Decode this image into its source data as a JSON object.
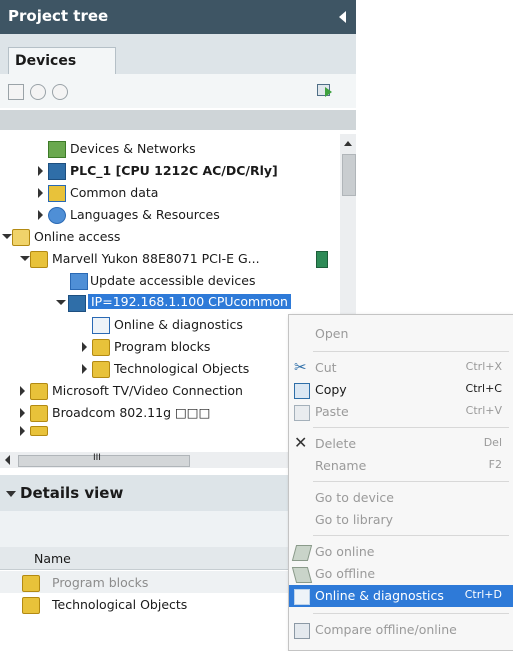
{
  "project_tree": {
    "title": "Project tree",
    "tab": "Devices"
  },
  "tree": {
    "devices_networks": "Devices & Networks",
    "plc": "PLC_1 [CPU 1212C AC/DC/Rly]",
    "common_data": "Common data",
    "languages": "Languages & Resources",
    "online_access": "Online access",
    "adapter": "Marvell Yukon 88E8071 PCI-E G...",
    "update_devices": "Update accessible devices",
    "ip_node": "IP=192.168.1.100 CPUcommon",
    "online_diag": "Online & diagnostics",
    "program_blocks": "Program blocks",
    "tech_objects": "Technological Objects",
    "microsoft": "Microsoft TV/Video Connection",
    "broadcom": "Broadcom 802.11g □□□",
    "scroll_glyph": "III"
  },
  "details": {
    "title": "Details view",
    "column_name": "Name",
    "rows": [
      "Program blocks",
      "Technological Objects"
    ]
  },
  "context_menu": {
    "open": "Open",
    "cut": "Cut",
    "cut_sc": "Ctrl+X",
    "copy": "Copy",
    "copy_sc": "Ctrl+C",
    "paste": "Paste",
    "paste_sc": "Ctrl+V",
    "delete": "Delete",
    "delete_sc": "Del",
    "rename": "Rename",
    "rename_sc": "F2",
    "go_to_device": "Go to device",
    "go_to_library": "Go to library",
    "go_online": "Go online",
    "go_offline": "Go offline",
    "online_diag": "Online & diagnostics",
    "online_diag_sc": "Ctrl+D",
    "compare": "Compare offline/online"
  },
  "colors": {
    "title_bar": "#3e5564",
    "selection": "#2e7ad8",
    "panel_header": "#dde4e8"
  }
}
